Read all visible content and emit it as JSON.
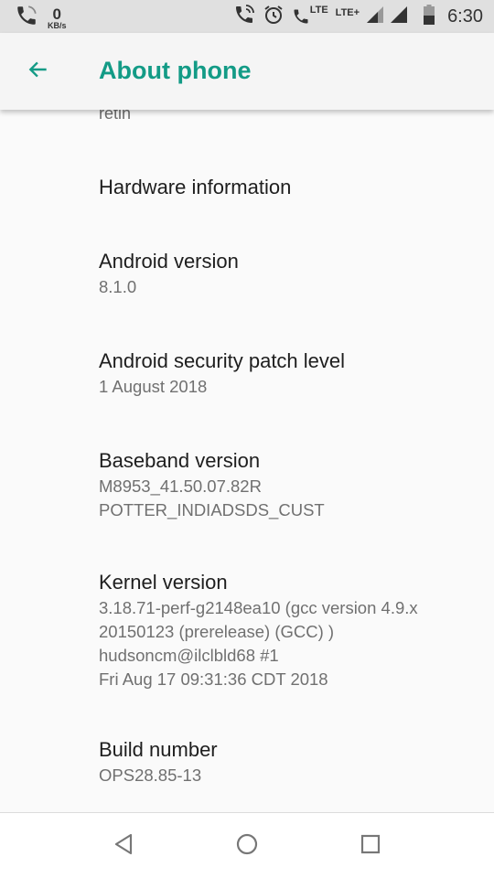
{
  "status_bar": {
    "data_speed_value": "0",
    "data_speed_unit": "KB/s",
    "lte1": "LTE",
    "lte2": "LTE+",
    "time": "6:30",
    "icons": [
      "phone-call-icon",
      "wifi-calling-icon",
      "alarm-icon",
      "volte-call-icon",
      "signal-icon",
      "signal-icon",
      "battery-icon"
    ]
  },
  "app_bar": {
    "title": "About phone",
    "accent_color": "#139b86"
  },
  "partial_item_text": "retin",
  "items": [
    {
      "title": "Hardware information",
      "lines": []
    },
    {
      "title": "Android version",
      "lines": [
        "8.1.0"
      ]
    },
    {
      "title": "Android security patch level",
      "lines": [
        "1 August 2018"
      ]
    },
    {
      "title": "Baseband version",
      "lines": [
        "M8953_41.50.07.82R",
        "POTTER_INDIADSDS_CUST"
      ]
    },
    {
      "title": "Kernel version",
      "lines": [
        "3.18.71-perf-g2148ea10 (gcc version 4.9.x",
        "20150123 (prerelease) (GCC) )",
        "hudsoncm@ilclbld68 #1",
        "Fri Aug 17 09:31:36 CDT 2018"
      ]
    },
    {
      "title": "Build number",
      "lines": [
        "OPS28.85-13"
      ]
    }
  ],
  "nav_bar": {
    "buttons": [
      "back",
      "home",
      "recents"
    ]
  }
}
